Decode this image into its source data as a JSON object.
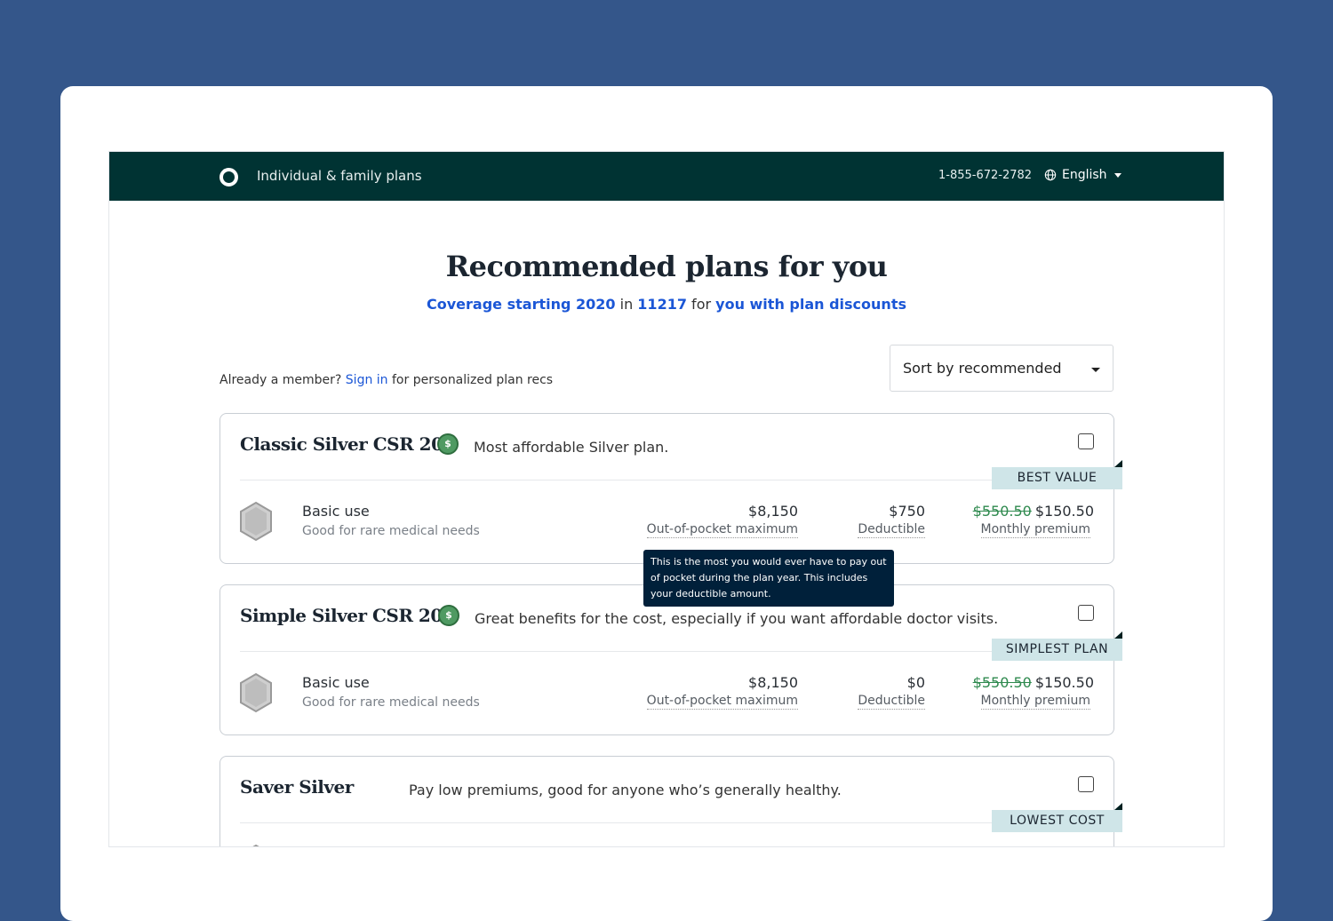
{
  "header": {
    "brand": "Individual & family plans",
    "phone": "1-855-672-2782",
    "language": "English"
  },
  "page": {
    "title": "Recommended plans for you",
    "subtitle": {
      "coverage": "Coverage starting 2020",
      "in": " in ",
      "zip": "11217",
      "for": " for ",
      "who": "you with plan discounts"
    },
    "member_prefix": "Already a member? ",
    "sign_in": "Sign in",
    "member_suffix": " for personalized plan recs",
    "sort_label": "Sort by recommended"
  },
  "tooltip": "This is the most you would ever have to pay out of pocket during the plan year. This includes your deductible amount.",
  "plans": [
    {
      "name": "Classic Silver CSR 200",
      "coin": "$",
      "description": "Most affordable Silver plan.",
      "badge": "BEST VALUE",
      "usage": "Basic use",
      "usage_sub": "Good for rare medical needs",
      "oop_max": "$8,150",
      "oop_label": "Out-of-pocket maximum",
      "deductible": "$750",
      "deductible_label": "Deductible",
      "old_premium": "$550.50",
      "premium": "$150.50",
      "premium_label": "Monthly premium"
    },
    {
      "name": "Simple Silver CSR 200",
      "coin": "$",
      "description": "Great benefits for the cost, especially if you want affordable doctor visits.",
      "badge": "SIMPLEST PLAN",
      "usage": "Basic use",
      "usage_sub": "Good for rare medical needs",
      "oop_max": "$8,150",
      "oop_label": "Out-of-pocket maximum",
      "deductible": "$0",
      "deductible_label": "Deductible",
      "old_premium": "$550.50",
      "premium": "$150.50",
      "premium_label": "Monthly premium"
    },
    {
      "name": "Saver Silver",
      "description": "Pay low premiums, good for anyone who’s generally healthy.",
      "badge": "LOWEST COST"
    }
  ]
}
